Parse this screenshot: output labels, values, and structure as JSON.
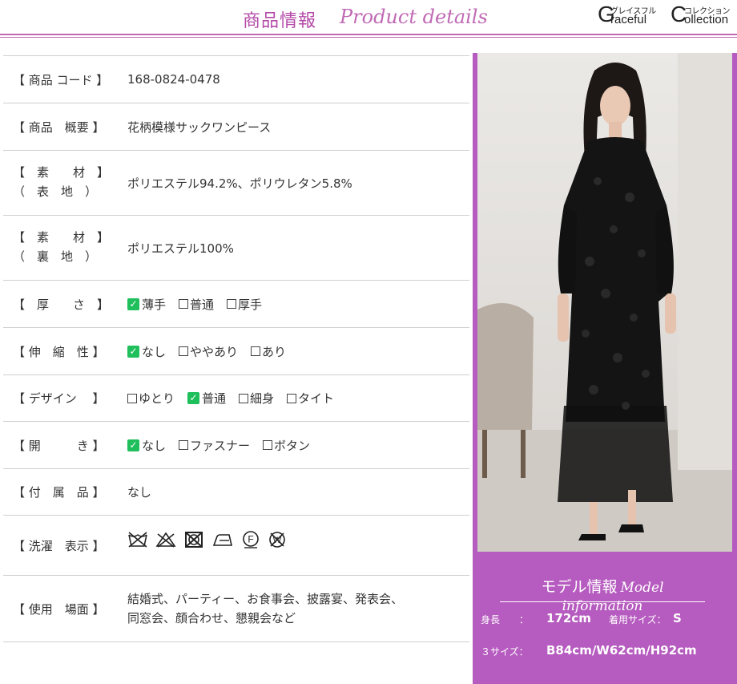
{
  "header": {
    "title_jp": "商品情報",
    "title_en": "Product details",
    "brand": {
      "kana1": "グレイスフル",
      "kana2": "コレクション",
      "letter1": "G",
      "word1": "raceful",
      "letter2": "C",
      "word2": "ollection"
    }
  },
  "specs": {
    "code": {
      "label": "【 商品 コード 】",
      "value": "168-0824-0478"
    },
    "summary": {
      "label": "【 商品　概要 】",
      "value": "花柄模様サックワンピース"
    },
    "material_outer": {
      "label1": "【　素　　材　】",
      "label2": "（　表　地　）",
      "value": "ポリエステル94.2%、ポリウレタン5.8%"
    },
    "material_inner": {
      "label1": "【　素　　材　】",
      "label2": "（　裏　地　）",
      "value": "ポリエステル100%"
    },
    "thickness": {
      "label": "【　厚　　さ　】",
      "options": [
        "薄手",
        "普通",
        "厚手"
      ],
      "selected": 0
    },
    "stretch": {
      "label": "【 伸　縮　性 】",
      "options": [
        "なし",
        "ややあり",
        "あり"
      ],
      "selected": 0
    },
    "design": {
      "label": "【 デザイン　 】",
      "options": [
        "ゆとり",
        "普通",
        "細身",
        "タイト"
      ],
      "selected": 1
    },
    "opening": {
      "label": "【 開　　　き 】",
      "options": [
        "なし",
        "ファスナー",
        "ボタン"
      ],
      "selected": 0
    },
    "accessories": {
      "label": "【 付　属　品 】",
      "value": "なし"
    },
    "washing": {
      "label": "【 洗濯　表示 】",
      "icons": [
        "no-wash-icon",
        "no-bleach-icon",
        "no-tumble-dry-icon",
        "low-iron-icon",
        "dry-clean-f-icon",
        "no-wet-clean-icon"
      ]
    },
    "usage": {
      "label": "【 使用　場面 】",
      "line1": "結婚式、パーティー、お食事会、披露宴、発表会、",
      "line2": "同窓会、顔合わせ、懇親会など"
    }
  },
  "model": {
    "title_jp": "モデル情報",
    "title_en": "Model information",
    "height_label": "身長　　：",
    "height_value": "172cm",
    "size_label": "着用サイズ：",
    "size_value": "S",
    "three_size_label": "３サイズ：",
    "three_size_value": "B84cm/W62cm/H92cm"
  },
  "colors": {
    "accent": "#b65bbf",
    "title": "#b44aa8",
    "check": "#1fbf5c"
  }
}
